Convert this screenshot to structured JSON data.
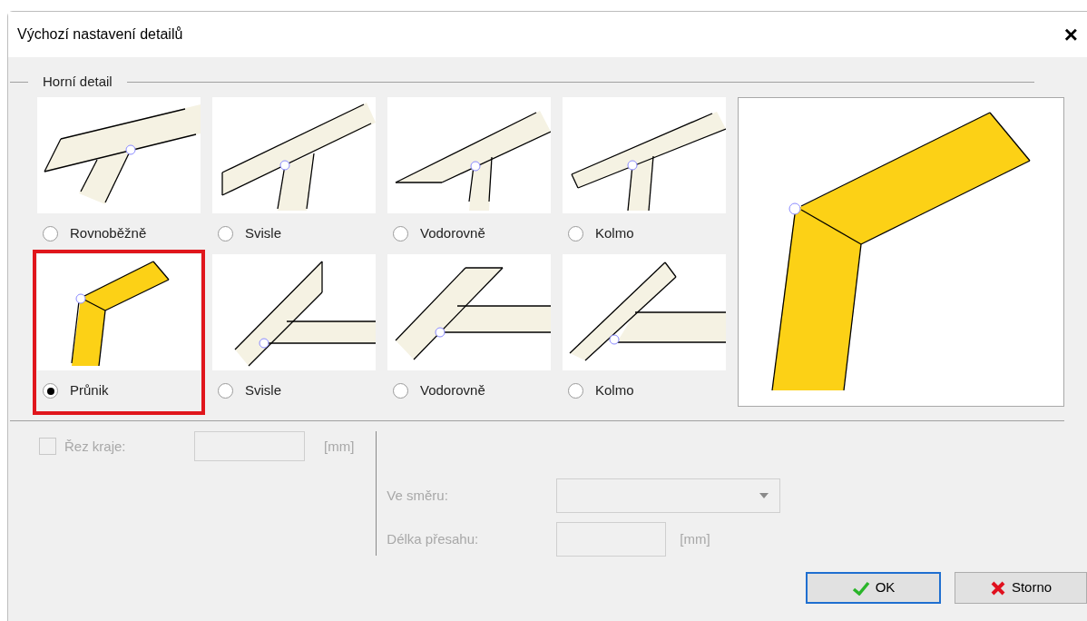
{
  "window": {
    "title": "Výchozí nastavení detailů",
    "close": "×"
  },
  "group": {
    "title": "Horní detail",
    "options": [
      {
        "label": "Rovnoběžně",
        "kind": "parallel",
        "selected": false,
        "highlighted": false
      },
      {
        "label": "Svisle",
        "kind": "vertical",
        "selected": false,
        "highlighted": false
      },
      {
        "label": "Vodorovně",
        "kind": "horizontal",
        "selected": false,
        "highlighted": false
      },
      {
        "label": "Kolmo",
        "kind": "perpendicular",
        "selected": false,
        "highlighted": false
      },
      {
        "label": "Průnik",
        "kind": "intersection",
        "selected": true,
        "highlighted": true
      },
      {
        "label": "Svisle",
        "kind": "side-vertical",
        "selected": false,
        "highlighted": false
      },
      {
        "label": "Vodorovně",
        "kind": "side-horizontal",
        "selected": false,
        "highlighted": false
      },
      {
        "label": "Kolmo",
        "kind": "side-perpendicular",
        "selected": false,
        "highlighted": false
      }
    ]
  },
  "edge_cut": {
    "label": "Řez kraje:",
    "checked": false,
    "disabled": true,
    "unit": "[mm]"
  },
  "direction": {
    "label": "Ve směru:",
    "disabled": true
  },
  "overhang": {
    "label": "Délka přesahu:",
    "disabled": true,
    "unit": "[mm]"
  },
  "buttons": [
    {
      "label": "OK",
      "kind": "ok"
    },
    {
      "label": "Storno",
      "kind": "cancel"
    }
  ]
}
